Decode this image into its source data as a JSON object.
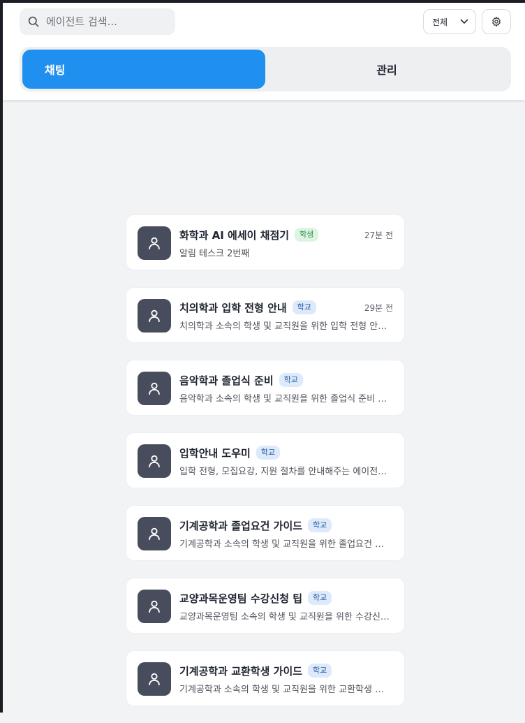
{
  "header": {
    "search": {
      "placeholder": "에이전트 검색...",
      "value": ""
    },
    "filter": {
      "selected": "전체"
    },
    "tabs": [
      {
        "label": "채팅",
        "active": true
      },
      {
        "label": "관리",
        "active": false
      }
    ]
  },
  "colors": {
    "accent": "#1f8ff0",
    "avatar_bg": "#474d5c"
  },
  "agents": [
    {
      "name": "화학과 AI 에세이 채점기",
      "badge": "학생",
      "badge_type": "student",
      "time": "27분 전",
      "description": "알림 테스크 2번째"
    },
    {
      "name": "치의학과 입학 전형 안내",
      "badge": "학교",
      "badge_type": "school",
      "time": "29분 전",
      "description": "치의학과 소속의 학생 및 교직원을 위한 입학 전형 안내 에이전트입니다."
    },
    {
      "name": "음악학과 졸업식 준비",
      "badge": "학교",
      "badge_type": "school",
      "time": "",
      "description": "음악학과 소속의 학생 및 교직원을 위한 졸업식 준비 에이전트입니다."
    },
    {
      "name": "입학안내 도우미",
      "badge": "학교",
      "badge_type": "school",
      "time": "",
      "description": "입학 전형, 모집요강, 지원 절차를 안내해주는 에이전트입니다."
    },
    {
      "name": "기계공학과 졸업요건 가이드",
      "badge": "학교",
      "badge_type": "school",
      "time": "",
      "description": "기계공학과 소속의 학생 및 교직원을 위한 졸업요건 가이드 에이전트입니다."
    },
    {
      "name": "교양과목운영팀 수강신청 팁",
      "badge": "학교",
      "badge_type": "school",
      "time": "",
      "description": "교양과목운영팀 소속의 학생 및 교직원을 위한 수강신청 팁 에이전트입니다."
    },
    {
      "name": "기계공학과 교환학생 가이드",
      "badge": "학교",
      "badge_type": "school",
      "time": "",
      "description": "기계공학과 소속의 학생 및 교직원을 위한 교환학생 가이드 에이전트입니다."
    }
  ],
  "icons": {
    "search": "search-icon",
    "chevron": "chevron-down-icon",
    "settings": "gear-icon",
    "avatar": "user-icon"
  }
}
